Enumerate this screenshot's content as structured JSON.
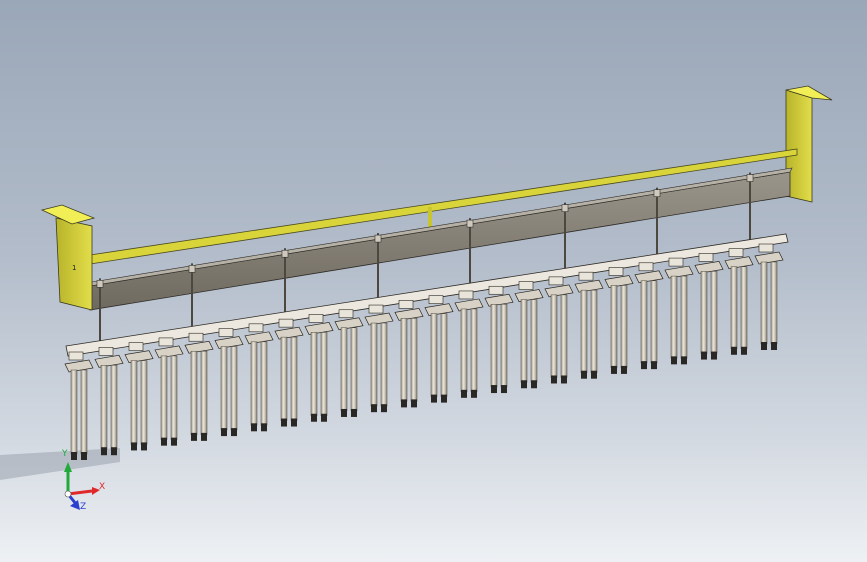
{
  "viewport": {
    "background_top": "#9aa7b8",
    "background_bottom": "#eef1f4"
  },
  "model": {
    "frame_color": "#d4d12e",
    "beam_color": "#8a8478",
    "rail_color": "#e4e0d6",
    "rod_color": "#cfc8bb",
    "rod_count": 24,
    "end_plate_mark": "1"
  },
  "triad": {
    "x_label": "X",
    "y_label": "Y",
    "z_label": "Z",
    "x_color": "#e0282a",
    "y_color": "#1faa3a",
    "z_color": "#2a3fd0"
  }
}
